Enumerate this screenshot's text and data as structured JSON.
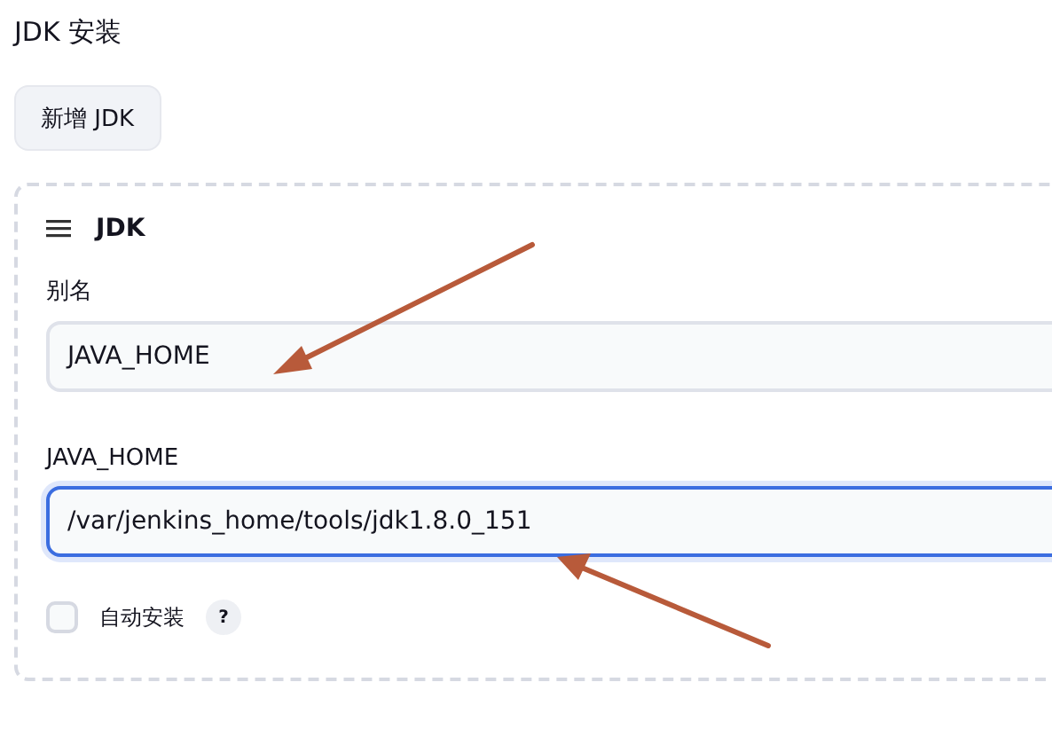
{
  "section_title": "JDK 安装",
  "add_button": "新增 JDK",
  "card": {
    "title": "JDK",
    "fields": [
      {
        "label": "别名",
        "value": "JAVA_HOME",
        "focused": false
      },
      {
        "label": "JAVA_HOME",
        "value": "/var/jenkins_home/tools/jdk1.8.0_151",
        "focused": true
      }
    ],
    "auto_install": {
      "label": "自动安装",
      "checked": false,
      "help": "?"
    }
  }
}
